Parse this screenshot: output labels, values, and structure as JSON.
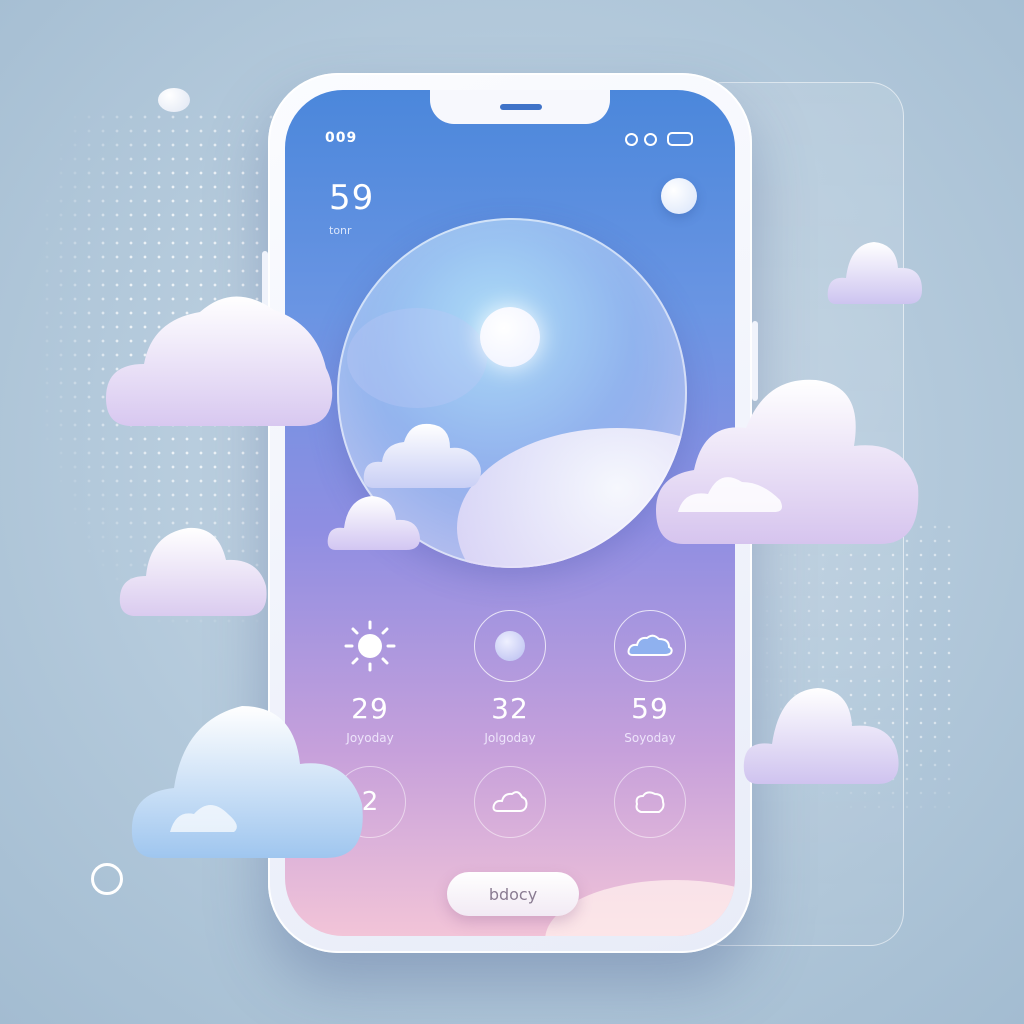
{
  "status_bar": {
    "left_icons": "009",
    "right_icons": [
      "signal-dot",
      "signal-dot",
      "battery"
    ]
  },
  "header": {
    "temperature": "59",
    "label": "tonr"
  },
  "forecast": [
    {
      "icon": "sun-icon",
      "temp": "29",
      "day": "Joyoday"
    },
    {
      "icon": "circle-icon",
      "temp": "32",
      "day": "Jolgoday"
    },
    {
      "icon": "cloud-icon",
      "temp": "59",
      "day": "Soyoday"
    }
  ],
  "forecast_row2": [
    {
      "icon": "number-badge",
      "text": "2"
    },
    {
      "icon": "cloud-outline-icon",
      "text": ""
    },
    {
      "icon": "cloud-outline-icon",
      "text": ""
    }
  ],
  "action_button": {
    "label": "bdocy"
  },
  "colors": {
    "screen_top": "#4b87db",
    "screen_mid": "#8f8ee2",
    "screen_bottom": "#f2c4d8",
    "background": "#b3c9db"
  }
}
